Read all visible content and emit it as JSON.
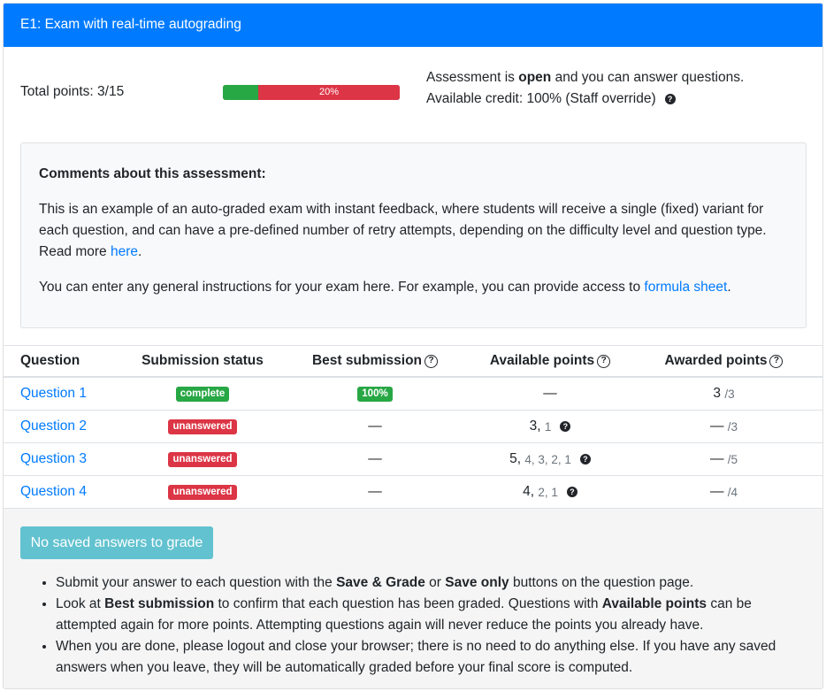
{
  "header": {
    "title": "E1: Exam with real-time autograding"
  },
  "summary": {
    "total_points": "Total points: 3/15",
    "progress_percent": 20,
    "progress_label": "20%",
    "status_prefix": "Assessment is ",
    "status_word": "open",
    "status_suffix": " and you can answer questions.",
    "credit": "Available credit: 100% (Staff override)",
    "help_glyph": "?"
  },
  "comments": {
    "heading": "Comments about this assessment:",
    "p1_text": "This is an example of an auto-graded exam with instant feedback, where students will receive a single (fixed) variant for each question, and can have a pre-defined number of retry attempts, depending on the difficulty level and question type. Read more ",
    "p1_link": "here",
    "p1_end": ".",
    "p2_text": "You can enter any general instructions for your exam here. For example, you can provide access to ",
    "p2_link": "formula sheet",
    "p2_end": "."
  },
  "table": {
    "headers": {
      "question": "Question",
      "submission_status": "Submission status",
      "best_submission": "Best submission",
      "available_points": "Available points",
      "awarded_points": "Awarded points"
    },
    "rows": [
      {
        "question": "Question 1",
        "status": "complete",
        "best": "100%",
        "avail_main": "—",
        "avail_rest": "",
        "awarded": "3",
        "max": "/3"
      },
      {
        "question": "Question 2",
        "status": "unanswered",
        "best": "—",
        "avail_main": "3,",
        "avail_rest": "1",
        "awarded": "—",
        "max": "/3"
      },
      {
        "question": "Question 3",
        "status": "unanswered",
        "best": "—",
        "avail_main": "5,",
        "avail_rest": "4, 3, 2, 1",
        "awarded": "—",
        "max": "/5"
      },
      {
        "question": "Question 4",
        "status": "unanswered",
        "best": "—",
        "avail_main": "4,",
        "avail_rest": "2, 1",
        "awarded": "—",
        "max": "/4"
      }
    ]
  },
  "footer": {
    "button_label": "No saved answers to grade",
    "b1_pre": "Submit your answer to each question with the ",
    "b1_bold1": "Save & Grade",
    "b1_mid": " or ",
    "b1_bold2": "Save only",
    "b1_post": " buttons on the question page.",
    "b2_pre": "Look at ",
    "b2_bold1": "Best submission",
    "b2_mid": " to confirm that each question has been graded. Questions with ",
    "b2_bold2": "Available points",
    "b2_post": " can be attempted again for more points. Attempting questions again will never reduce the points you already have.",
    "b3": "When you are done, please logout and close your browser; there is no need to do anything else. If you have any saved answers when you leave, they will be automatically graded before your final score is computed."
  },
  "colors": {
    "header": "#007bff",
    "success": "#28a745",
    "danger": "#dc3545",
    "info_button": "#5bc0ce"
  }
}
